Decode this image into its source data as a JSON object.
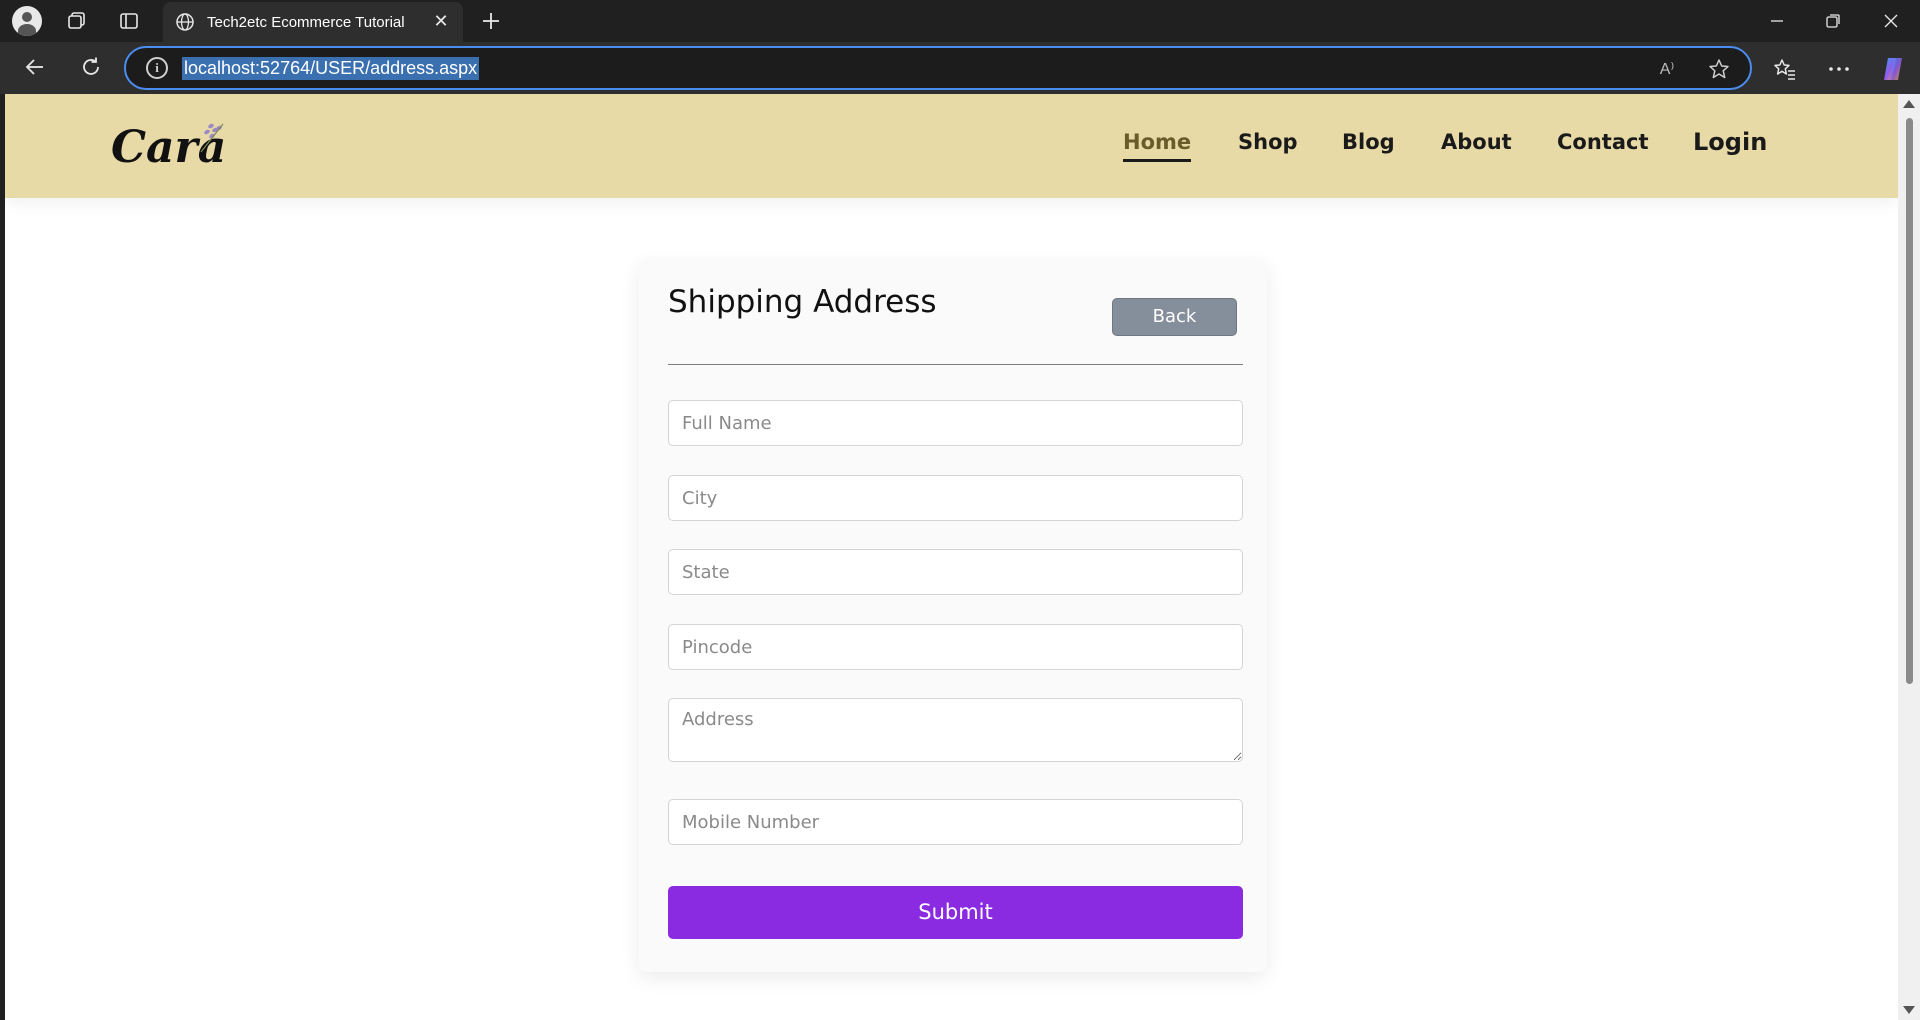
{
  "browser": {
    "tab_title": "Tech2etc Ecommerce Tutorial",
    "url": "localhost:52764/USER/address.aspx",
    "read_aloud_label": "A⁾"
  },
  "site": {
    "logo_text": "Cara",
    "nav": [
      {
        "label": "Home",
        "active": true
      },
      {
        "label": "Shop"
      },
      {
        "label": "Blog"
      },
      {
        "label": "About"
      },
      {
        "label": "Contact"
      },
      {
        "label": "Login"
      }
    ]
  },
  "form": {
    "title": "Shipping Address",
    "back_label": "Back",
    "fields": {
      "full_name": "Full Name",
      "city": "City",
      "state": "State",
      "pincode": "Pincode",
      "address": "Address",
      "mobile": "Mobile Number"
    },
    "submit_label": "Submit"
  },
  "colors": {
    "header_bg": "#e8daa6",
    "submit_bg": "#8a2be2",
    "back_bg": "#858e9b",
    "address_focus": "#4a8cf0"
  }
}
